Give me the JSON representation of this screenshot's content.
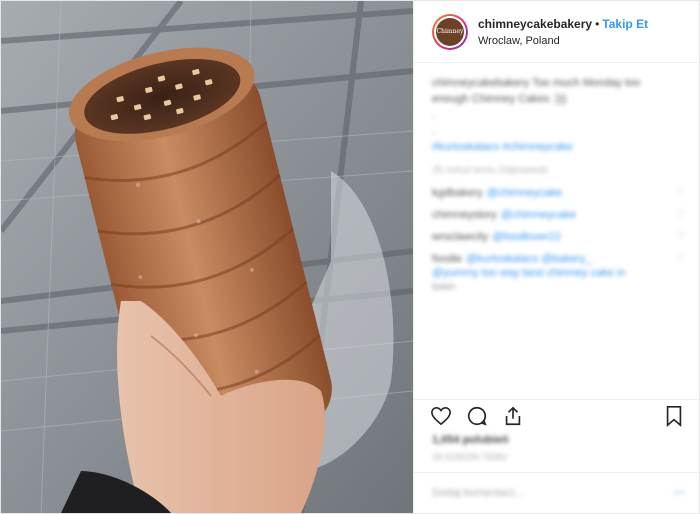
{
  "header": {
    "avatar_text": "Chimney",
    "username": "chimneycakebakery",
    "separator": "•",
    "follow_label": "Takip Et",
    "location": "Wroclaw, Poland"
  },
  "caption": {
    "line1": "chimneycakebakery Too much Monday too",
    "line2": "enough Chimney Cakes :)))",
    "line3": ".",
    "line4": ".",
    "hashtag": "#kurtoskalacs #chimneycake"
  },
  "meta_text": "25 minut temu Odpowiedz",
  "comments": [
    {
      "name": "kgdbakery",
      "text": "@chimneycake"
    },
    {
      "name": "chimneystory",
      "text": "@chimneycake"
    },
    {
      "name": "wroclawcity",
      "text": "@foodlover22"
    },
    {
      "name": "foodie",
      "text": "@kurtoskalacs @bakery_",
      "text2": "@yummy too way best chimney cake in",
      "text3": "town"
    }
  ],
  "likes_text": "1,054 polubień",
  "time_text": "18 GODZIN TEMU",
  "add_comment_placeholder": "Dodaj komentarz...",
  "post_label": "Opublikuj",
  "colors": {
    "follow": "#3897f0",
    "border": "#efefef"
  },
  "icons": [
    "heart-icon",
    "comment-icon",
    "share-icon",
    "bookmark-icon",
    "more-dots-icon"
  ]
}
